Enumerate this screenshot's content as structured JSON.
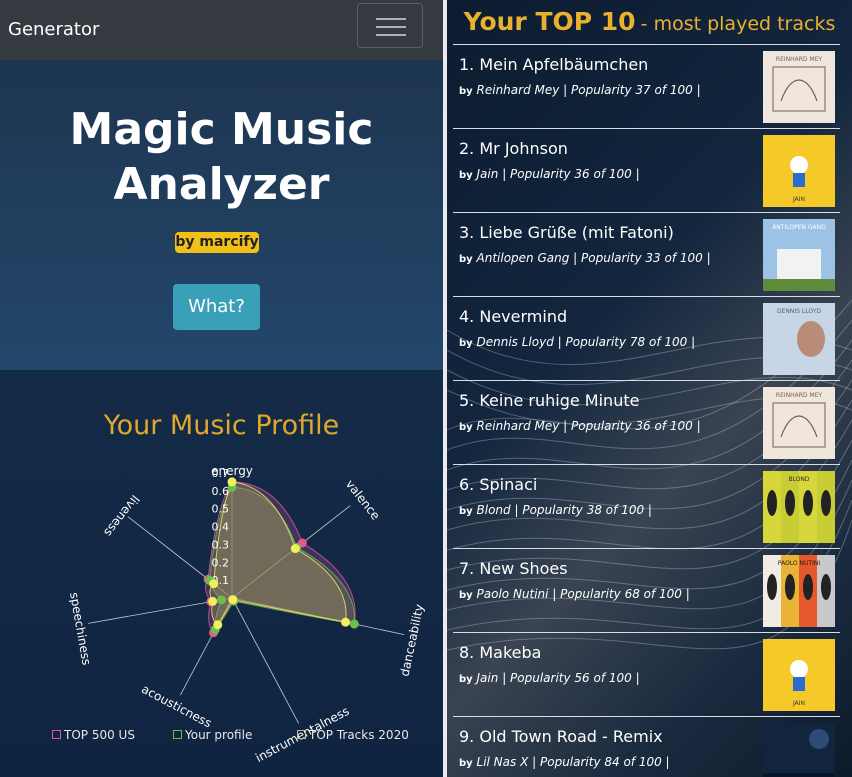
{
  "navbar": {
    "brand": "Generator",
    "menu_icon": "hamburger-icon"
  },
  "hero": {
    "title": "Magic Music Analyzer",
    "badge": "by marcify",
    "what_button": "What?"
  },
  "profile": {
    "title": "Your Music Profile",
    "axes": [
      "energy",
      "valence",
      "danceability",
      "instrumentalness",
      "acousticness",
      "speechiness",
      "liveness"
    ],
    "ticks": [
      "0.7",
      "0.6",
      "0.5",
      "0.4",
      "0.3",
      "0.2",
      "0.1"
    ],
    "legend": [
      {
        "label": "TOP 500 US",
        "color": "#e2598d"
      },
      {
        "label": "Your profile",
        "color": "#6abf4b"
      },
      {
        "label": "TOP Tracks 2020",
        "color": "#c6bd7c"
      }
    ]
  },
  "chart_data": {
    "type": "radar",
    "axes": [
      "energy",
      "valence",
      "danceability",
      "instrumentalness",
      "acousticness",
      "speechiness",
      "liveness"
    ],
    "range": [
      0,
      0.7
    ],
    "series": [
      {
        "name": "TOP 500 US",
        "color": "#e2598d",
        "values": [
          0.65,
          0.5,
          0.7,
          0.01,
          0.22,
          0.12,
          0.17
        ]
      },
      {
        "name": "Your profile",
        "color": "#6abf4b",
        "values": [
          0.62,
          0.46,
          0.7,
          0.02,
          0.2,
          0.06,
          0.16
        ]
      },
      {
        "name": "TOP Tracks 2020",
        "color": "#f2ee5c",
        "values": [
          0.65,
          0.45,
          0.65,
          0.01,
          0.17,
          0.11,
          0.13
        ]
      }
    ]
  },
  "top10": {
    "title_main": "Your TOP 10",
    "title_sub": "- most played tracks",
    "by": "by",
    "tracks": [
      {
        "rank": "1.",
        "name": "Mein Apfelbäumchen",
        "artist": "Reinhard Mey",
        "popularity": "| Popularity 37 of 100 |"
      },
      {
        "rank": "2.",
        "name": "Mr Johnson",
        "artist": "Jain",
        "popularity": "| Popularity 36 of 100 |"
      },
      {
        "rank": "3.",
        "name": "Liebe Grüße (mit Fatoni)",
        "artist": "Antilopen Gang",
        "popularity": "| Popularity 33 of 100 |"
      },
      {
        "rank": "4.",
        "name": "Nevermind",
        "artist": "Dennis Lloyd",
        "popularity": "| Popularity 78 of 100 |"
      },
      {
        "rank": "5.",
        "name": "Keine ruhige Minute",
        "artist": "Reinhard Mey",
        "popularity": "| Popularity 36 of 100 |"
      },
      {
        "rank": "6.",
        "name": "Spinaci",
        "artist": "Blond",
        "popularity": "| Popularity 38 of 100 |"
      },
      {
        "rank": "7.",
        "name": "New Shoes",
        "artist": "Paolo Nutini",
        "popularity": "| Popularity 68 of 100 |"
      },
      {
        "rank": "8.",
        "name": "Makeba",
        "artist": "Jain",
        "popularity": "| Popularity 56 of 100 |"
      },
      {
        "rank": "9.",
        "name": "Old Town Road - Remix",
        "artist": "Lil Nas X",
        "popularity": "| Popularity 84 of 100 |"
      }
    ],
    "covers": [
      {
        "text": "REINHARD MEY",
        "bg": "#efe6dc",
        "fg": "#7a5e54"
      },
      {
        "text": "JAIN",
        "bg": "#f4c928",
        "fg": "#3a3a3a"
      },
      {
        "text": "ANTILOPEN GANG",
        "bg": "#9cc3e6",
        "fg": "#ffffff"
      },
      {
        "text": "DENNIS LLOYD",
        "bg": "#c7d5e6",
        "fg": "#50607a"
      },
      {
        "text": "REINHARD MEY",
        "bg": "#efe6dc",
        "fg": "#7a5e54"
      },
      {
        "text": "BLOND",
        "bg": "#d2d33a",
        "fg": "#2b2b2b"
      },
      {
        "text": "PAOLO NUTINI",
        "bg": "#e8a33a",
        "fg": "#1b1b1b"
      },
      {
        "text": "JAIN",
        "bg": "#f4c928",
        "fg": "#3a3a3a"
      },
      {
        "text": "",
        "bg": "#12253f",
        "fg": "#9fc4ff"
      }
    ]
  }
}
